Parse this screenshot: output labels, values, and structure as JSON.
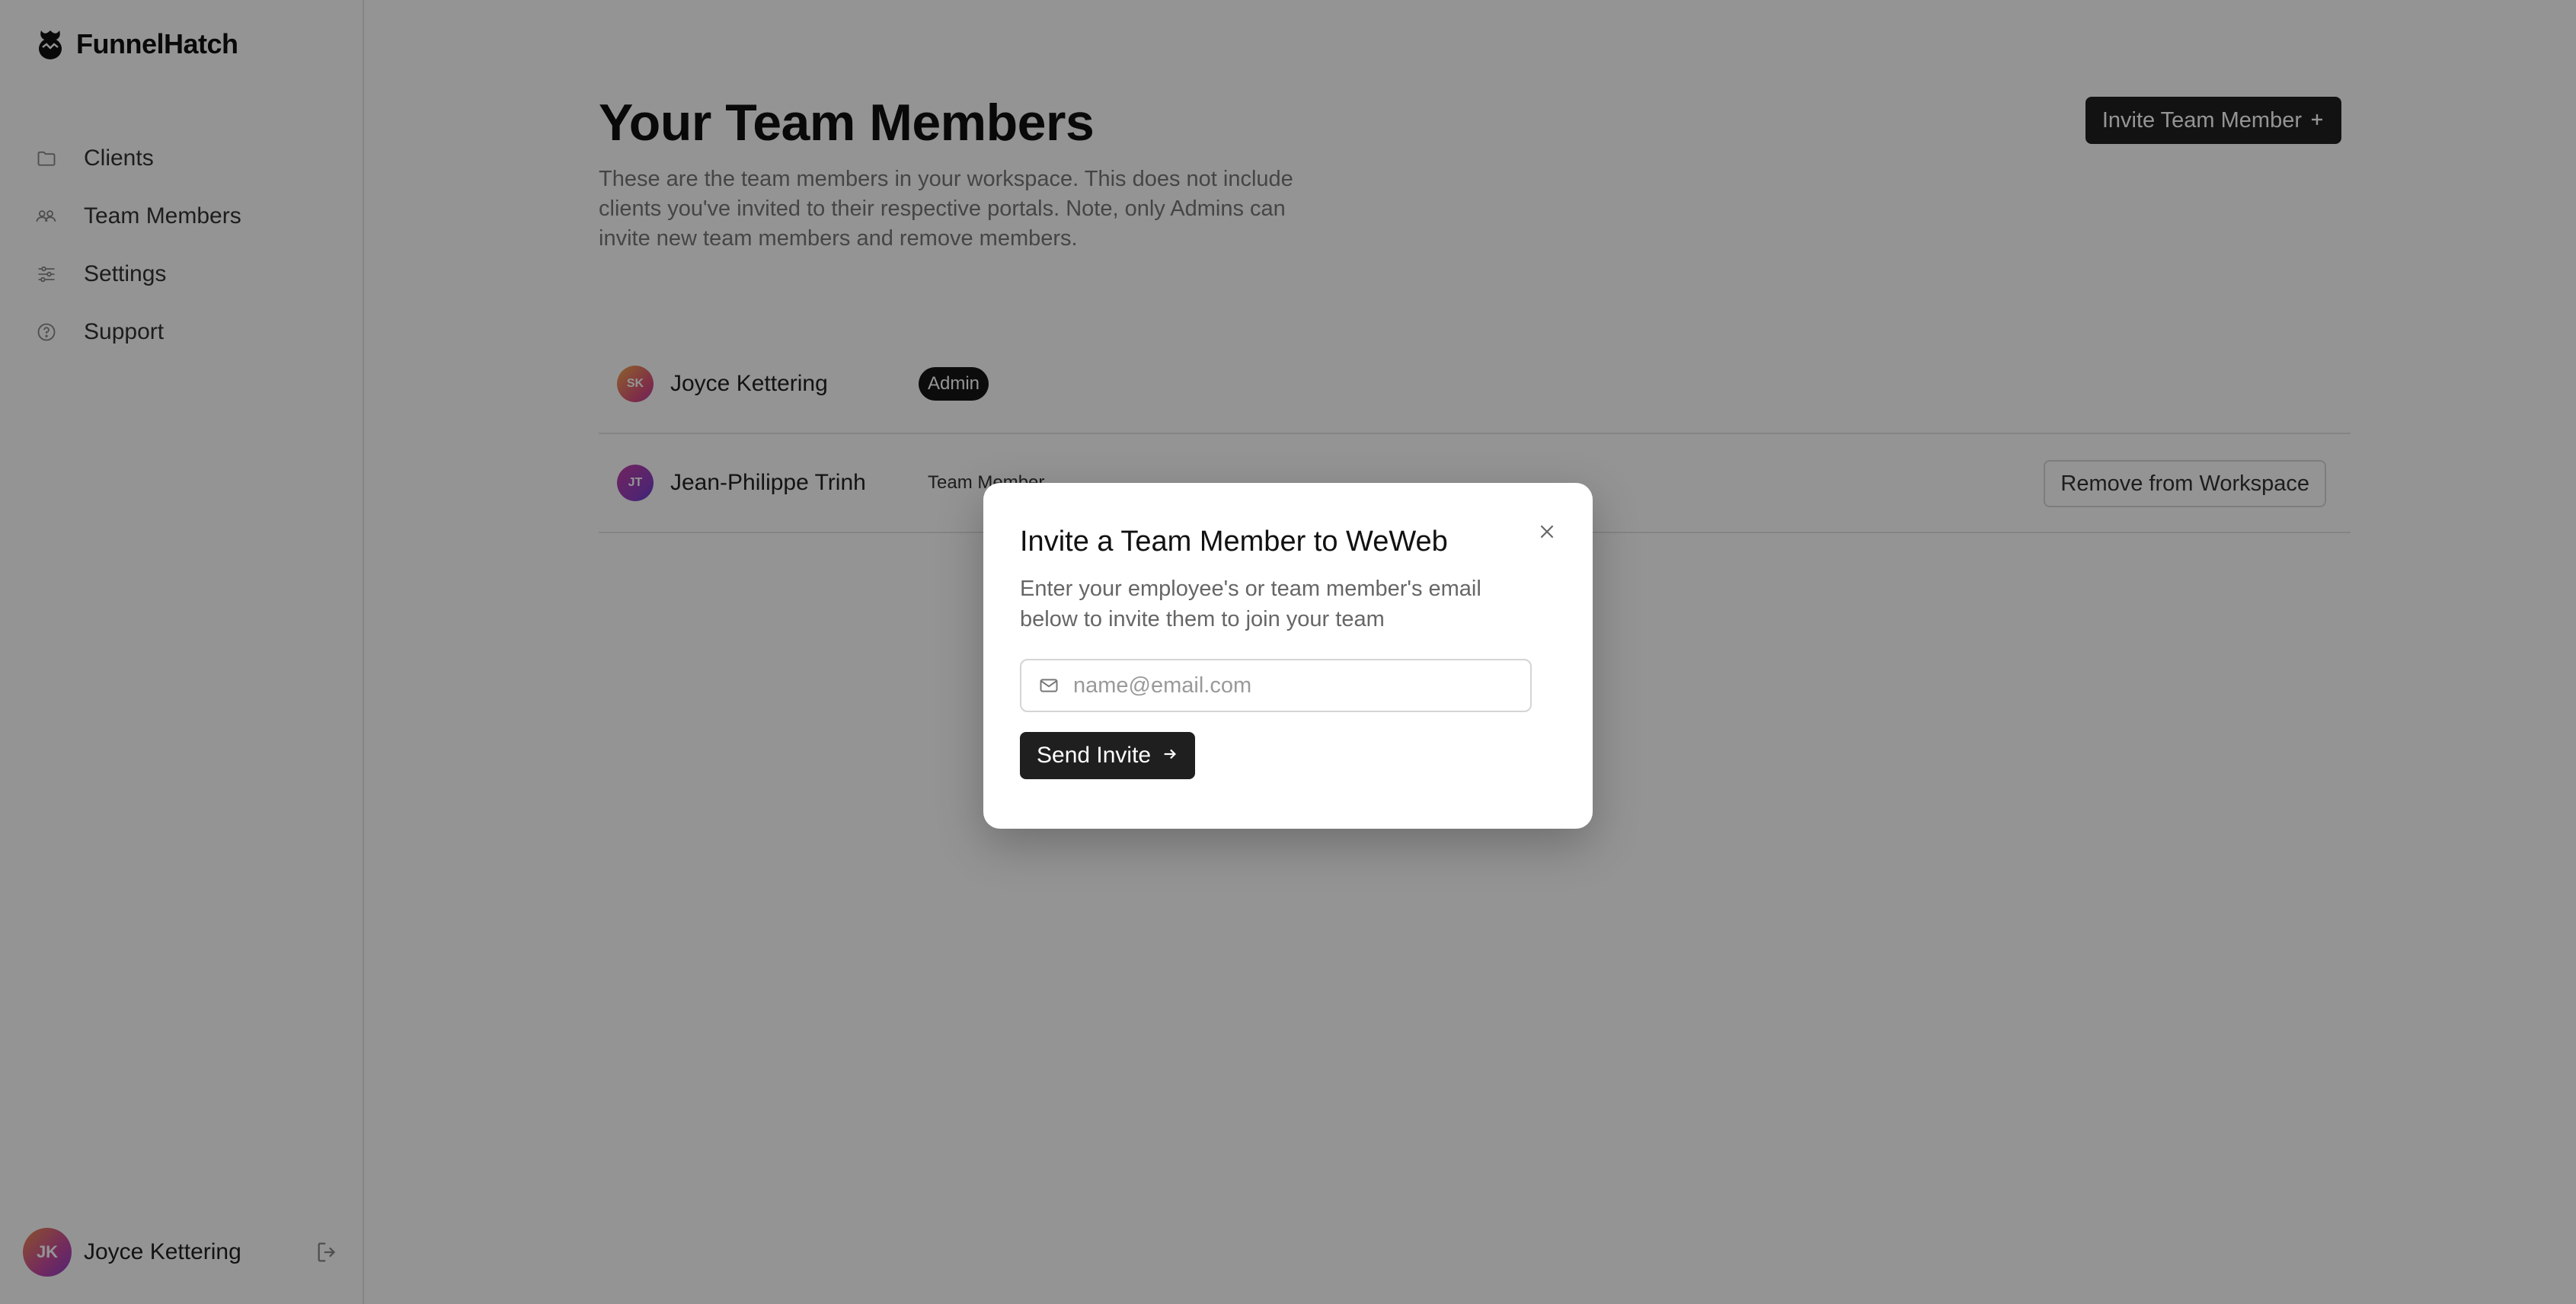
{
  "brand": {
    "name": "FunnelHatch",
    "icon": "hatch-logo-icon"
  },
  "sidebar": {
    "items": [
      {
        "label": "Clients",
        "icon": "folder-icon"
      },
      {
        "label": "Team Members",
        "icon": "users-icon"
      },
      {
        "label": "Settings",
        "icon": "sliders-icon"
      },
      {
        "label": "Support",
        "icon": "help-circle-icon"
      }
    ],
    "user": {
      "name": "Joyce Kettering",
      "initials": "JK",
      "action_icon": "logout-icon"
    }
  },
  "main": {
    "title": "Your Team Members",
    "description": "These are the team members in your workspace. This does not include clients you've invited to their respective portals. Note, only Admins can invite new team members and remove members.",
    "invite_button": "Invite Team Member",
    "invite_button_icon": "plus-icon",
    "members": [
      {
        "name": "Joyce Kettering",
        "initials": "SK",
        "role": "Admin"
      },
      {
        "name": "Jean-Philippe Trinh",
        "initials": "JT",
        "role": "Team Member",
        "action": "Remove from Workspace"
      }
    ]
  },
  "modal": {
    "title": "Invite a Team Member to WeWeb",
    "description": "Enter your employee's or team member's email below to invite them to join your team",
    "email_placeholder": "name@email.com",
    "email_value": "",
    "email_icon": "mail-icon",
    "send_button": "Send Invite",
    "send_icon": "arrow-right-icon",
    "close_icon": "close-icon"
  },
  "colors": {
    "primary_button": "#1f1f1f",
    "overlay": "rgba(0,0,0,0.42)",
    "muted_text": "#777777"
  }
}
